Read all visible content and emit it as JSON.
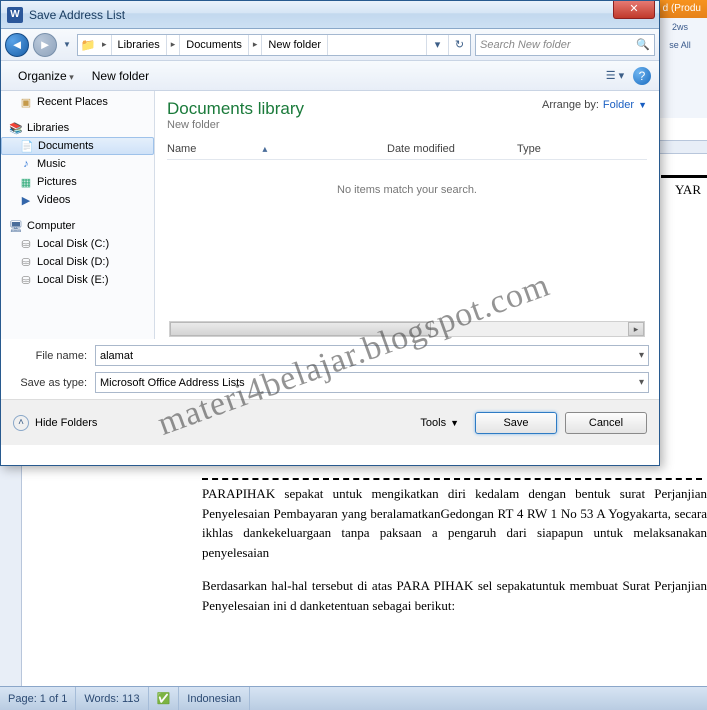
{
  "word_title_suffix": "d (Produ",
  "ribbon": {
    "item1": "2ws",
    "item2": "se All"
  },
  "yara": "YAR",
  "document_paragraphs": [
    "PARAPIHAK sepakat untuk mengikatkan diri kedalam dengan bentuk surat Perjanjian Penyelesaian Pembayaran yang beralamatkanGedongan RT 4 RW 1 No 53 A Yogyakarta, secara ikhlas dankekeluargaan tanpa paksaan a pengaruh dari siapapun untuk melaksanakan penyelesaian",
    "Berdasarkan hal-hal tersebut di atas PARA PIHAK sel sepakatuntuk membuat Surat Perjanjian Penyelesaian ini d danketentuan sebagai berikut:"
  ],
  "statusbar": {
    "page": "Page: 1 of 1",
    "words": "Words: 113",
    "lang": "Indonesian"
  },
  "dialog": {
    "title": "Save Address List",
    "breadcrumb": [
      "Libraries",
      "Documents",
      "New folder"
    ],
    "search_placeholder": "Search New folder",
    "toolbar": {
      "organize": "Organize",
      "newfolder": "New folder"
    },
    "lib_title": "Documents library",
    "lib_sub": "New folder",
    "arrange_label": "Arrange by:",
    "arrange_value": "Folder",
    "columns": {
      "name": "Name",
      "date": "Date modified",
      "type": "Type"
    },
    "empty": "No items match your search.",
    "filename_label": "File name:",
    "filename_value": "alamat",
    "savetype_label": "Save as type:",
    "savetype_value": "Microsoft Office Address Lists",
    "hide_folders": "Hide Folders",
    "tools": "Tools",
    "save": "Save",
    "cancel": "Cancel"
  },
  "tree": {
    "recent": "Recent Places",
    "libraries": "Libraries",
    "documents": "Documents",
    "music": "Music",
    "pictures": "Pictures",
    "videos": "Videos",
    "computer": "Computer",
    "c": "Local Disk (C:)",
    "d": "Local Disk (D:)",
    "e": "Local Disk (E:)"
  },
  "watermark": "materi4belajar.blogspot.com"
}
